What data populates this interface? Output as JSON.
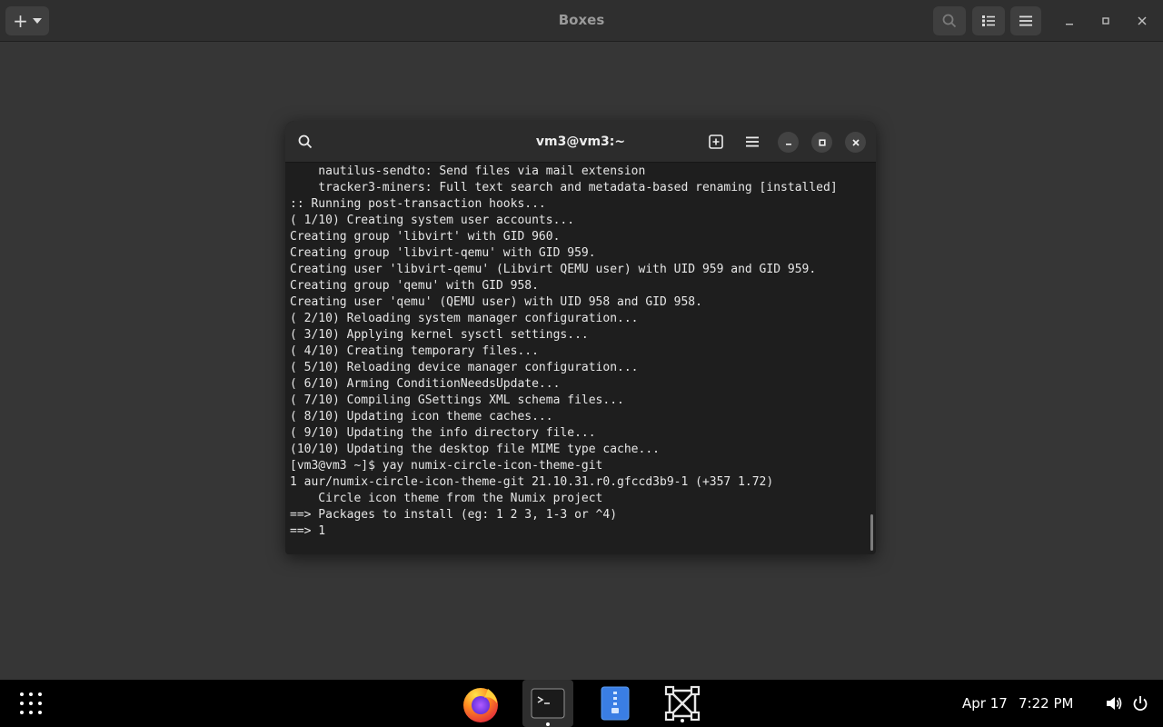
{
  "boxes": {
    "title": "Boxes",
    "new_label": "+"
  },
  "terminal": {
    "title": "vm3@vm3:~",
    "lines": [
      "    nautilus-sendto: Send files via mail extension",
      "    tracker3-miners: Full text search and metadata-based renaming [installed]",
      ":: Running post-transaction hooks...",
      "( 1/10) Creating system user accounts...",
      "Creating group 'libvirt' with GID 960.",
      "Creating group 'libvirt-qemu' with GID 959.",
      "Creating user 'libvirt-qemu' (Libvirt QEMU user) with UID 959 and GID 959.",
      "Creating group 'qemu' with GID 958.",
      "Creating user 'qemu' (QEMU user) with UID 958 and GID 958.",
      "( 2/10) Reloading system manager configuration...",
      "( 3/10) Applying kernel sysctl settings...",
      "( 4/10) Creating temporary files...",
      "( 5/10) Reloading device manager configuration...",
      "( 6/10) Arming ConditionNeedsUpdate...",
      "( 7/10) Compiling GSettings XML schema files...",
      "( 8/10) Updating icon theme caches...",
      "( 9/10) Updating the info directory file...",
      "(10/10) Updating the desktop file MIME type cache...",
      "[vm3@vm3 ~]$ yay numix-circle-icon-theme-git",
      "1 aur/numix-circle-icon-theme-git 21.10.31.r0.gfccd3b9-1 (+357 1.72)",
      "    Circle icon theme from the Numix project",
      "==> Packages to install (eg: 1 2 3, 1-3 or ^4)",
      "==> 1"
    ]
  },
  "taskbar": {
    "date": "Apr 17",
    "time": "7:22 PM",
    "apps": [
      "firefox-icon",
      "terminal-icon",
      "files-icon",
      "boxes-icon"
    ]
  },
  "colors": {
    "terminal_bg": "#1e1e1e",
    "header_bg": "#2f2f2f",
    "desktop_bg": "#363636"
  }
}
